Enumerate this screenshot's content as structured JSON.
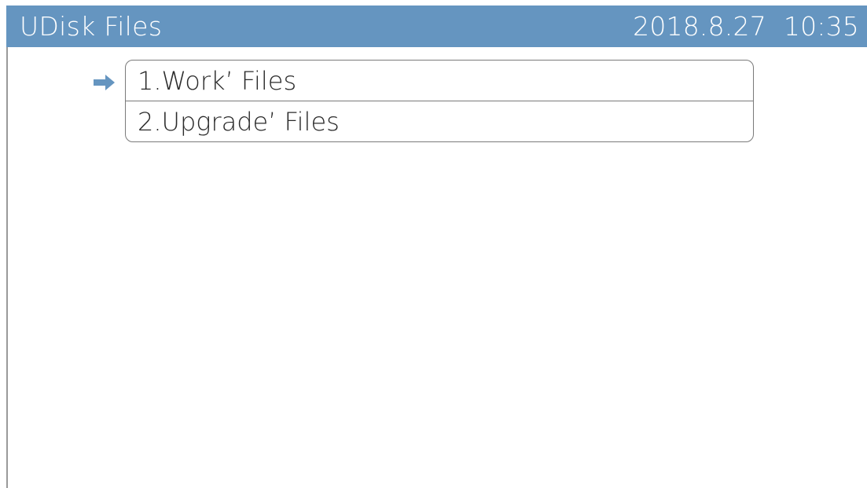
{
  "header": {
    "title": "UDisk Files",
    "date": "2018.8.27",
    "time": "10:35",
    "background_color": "#6595c0"
  },
  "menu": {
    "selected_index": 0,
    "cursor_icon": "right-arrow-icon",
    "items": [
      {
        "label": "1.Work’ Files"
      },
      {
        "label": "2.Upgrade’ Files"
      }
    ]
  }
}
